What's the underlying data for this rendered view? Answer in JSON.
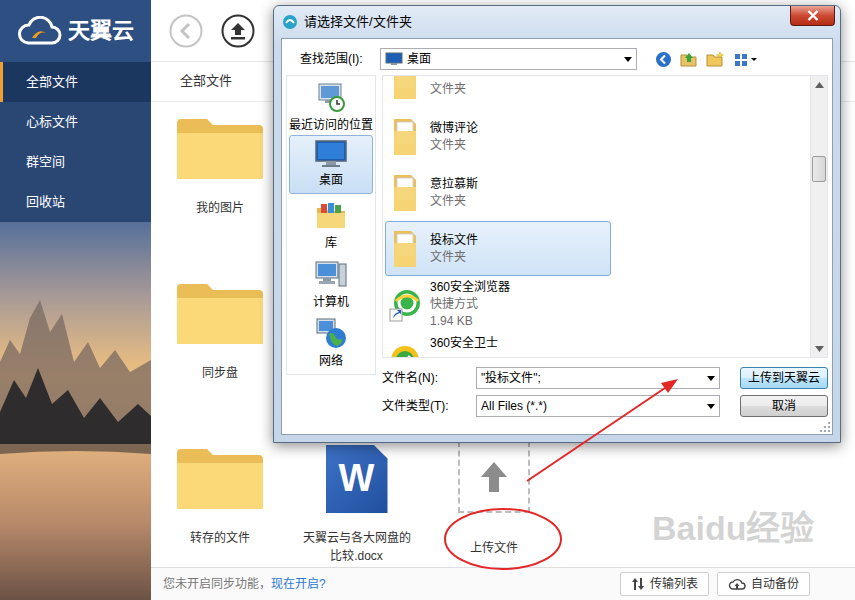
{
  "app": {
    "logo": "天翼云"
  },
  "sidebar": {
    "items": [
      {
        "label": "全部文件",
        "selected": true
      },
      {
        "label": "心标文件",
        "selected": false
      },
      {
        "label": "群空间",
        "selected": false
      },
      {
        "label": "回收站",
        "selected": false
      }
    ]
  },
  "breadcrumb": "全部文件",
  "files": [
    {
      "name": "我的图片",
      "kind": "folder"
    },
    {
      "name": "同步盘",
      "kind": "folder"
    },
    {
      "name": "转存的文件",
      "kind": "folder"
    },
    {
      "name": "天翼云与各大网盘的比较.docx",
      "kind": "word",
      "badge": "W"
    },
    {
      "name": "上传文件",
      "kind": "upload"
    }
  ],
  "status_bar": {
    "message": "您未开启同步功能，",
    "link": "现在开启?",
    "buttons": [
      "传输列表",
      "自动备份"
    ]
  },
  "dialog": {
    "title": "请选择文件/文件夹",
    "look_in": {
      "label": "查找范围(I):",
      "value": "桌面"
    },
    "places": [
      {
        "label": "最近访问的位置",
        "selected": false
      },
      {
        "label": "桌面",
        "selected": true
      },
      {
        "label": "库",
        "selected": false
      },
      {
        "label": "计算机",
        "selected": false
      },
      {
        "label": "网络",
        "selected": false
      }
    ],
    "items": [
      {
        "type": "文件夹",
        "kind": "folder",
        "selected": false
      },
      {
        "name": "微博评论",
        "type": "文件夹",
        "kind": "folder",
        "selected": false
      },
      {
        "name": "意拉慕斯",
        "type": "文件夹",
        "kind": "folder",
        "selected": false
      },
      {
        "name": "投标文件",
        "type": "文件夹",
        "kind": "folder",
        "selected": true
      },
      {
        "name": "360安全浏览器",
        "type": "快捷方式",
        "size": "1.94 KB",
        "kind": "browser",
        "selected": false
      },
      {
        "name": "360安全卫士",
        "kind": "guard",
        "selected": false
      }
    ],
    "filename": {
      "label": "文件名(N):",
      "value": "\"投标文件\";"
    },
    "filetype": {
      "label": "文件类型(T):",
      "value": "All Files (*.*)"
    },
    "buttons": [
      {
        "label": "上传到天翼云",
        "default": true
      },
      {
        "label": "取消",
        "default": false
      }
    ]
  },
  "watermark": "Baidu经验"
}
